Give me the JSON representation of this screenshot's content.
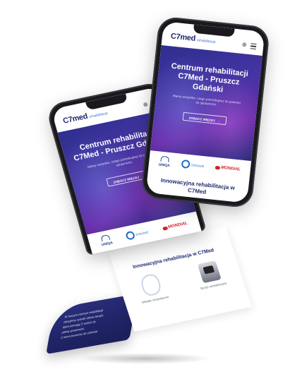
{
  "brand": {
    "logo_main": "C7med",
    "logo_sub": "rehabilitacja"
  },
  "hero": {
    "title_right": "Centrum rehabilitacji C7Med - Pruszcz Gdański",
    "title_left": "Centrum rehabilitacji C7Med - Pruszcz Gdański",
    "subtitle": "Mamy wszystko, czego potrzebujesz do powrotu do sprawności.",
    "cta_label": "ZOBACZ WIĘCEJ"
  },
  "partners": [
    {
      "name": "UNIQA"
    },
    {
      "name": "ZDROWIE"
    },
    {
      "name": "MONDIAL"
    }
  ],
  "section": {
    "title": "Innowacyjna rehabilitacja w C7Med"
  },
  "devices": [
    {
      "caption": "Wkładki ortopedyczne"
    },
    {
      "caption": "Sprzęt rehabilitacyjny"
    }
  ],
  "bottom_text": [
    "W naszym centrum rehabilitacji",
    "oferujemy szeroki zakres terapii,",
    "które pomogą Ci wrócić do",
    "pełnej sprawności.",
    "Z nami powrócisz do zdrowia!"
  ],
  "colors": {
    "brand_navy": "#1e2a6e",
    "hero_purple": "#4734a3",
    "mondial_red": "#d3202b",
    "accent_blue": "#1f6fc3"
  }
}
